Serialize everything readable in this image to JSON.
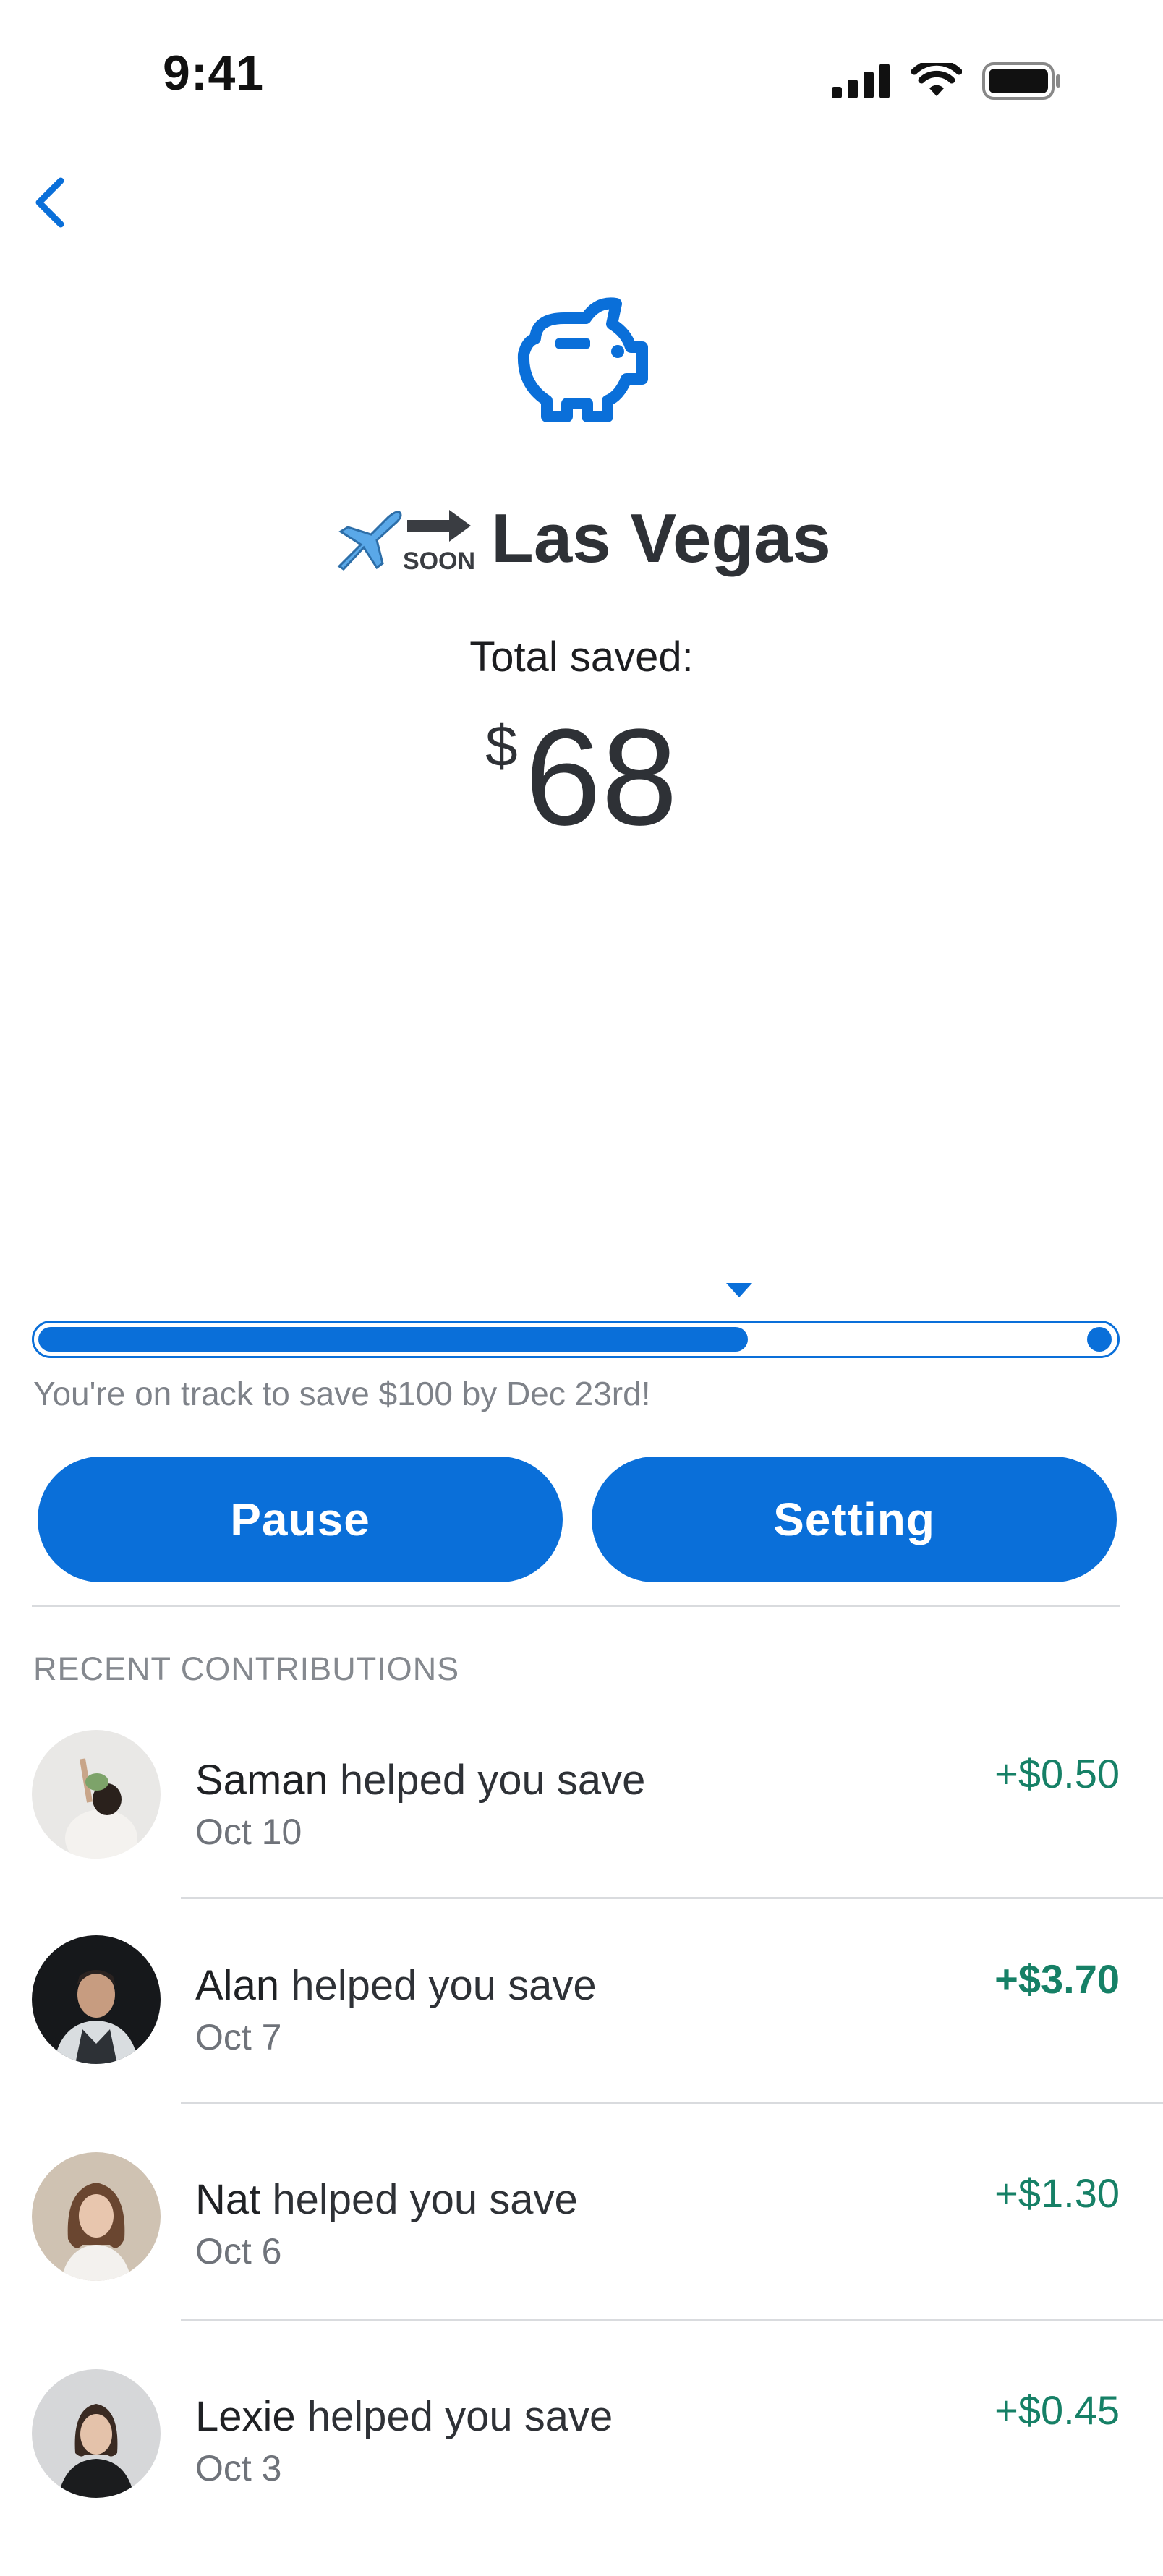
{
  "status_bar": {
    "time": "9:41"
  },
  "header": {
    "title": "Las Vegas",
    "emoji_word": "SOON"
  },
  "summary": {
    "label": "Total saved:",
    "currency": "$",
    "amount": "68"
  },
  "progress": {
    "fraction": 0.66,
    "message": "You're on track to save $100 by Dec 23rd!"
  },
  "actions": {
    "pause_label": "Pause",
    "setting_label": "Setting"
  },
  "contributions": {
    "heading": "RECENT CONTRIBUTIONS",
    "items": [
      {
        "name": "Saman",
        "text": "helped you save",
        "date": "Oct 10",
        "amount": "+$0.50",
        "avatar": "saman-avatar"
      },
      {
        "name": "Alan",
        "text": "helped you save",
        "date": "Oct 7",
        "amount": "+$3.70",
        "avatar": "alan-avatar"
      },
      {
        "name": "Nat",
        "text": "helped you save",
        "date": "Oct 6",
        "amount": "+$1.30",
        "avatar": "nat-avatar"
      },
      {
        "name": "Lexie",
        "text": "helped you save",
        "date": "Oct 3",
        "amount": "+$0.45",
        "avatar": "lexie-avatar"
      }
    ]
  },
  "colors": {
    "accent": "#0a6fd9",
    "positive": "#168066",
    "text": "#2e3136",
    "muted": "#7e8289"
  },
  "icons": [
    "signal-icon",
    "wifi-icon",
    "battery-icon",
    "back-chevron-icon",
    "piggy-bank-icon",
    "airplane-icon",
    "soon-arrow-icon"
  ]
}
